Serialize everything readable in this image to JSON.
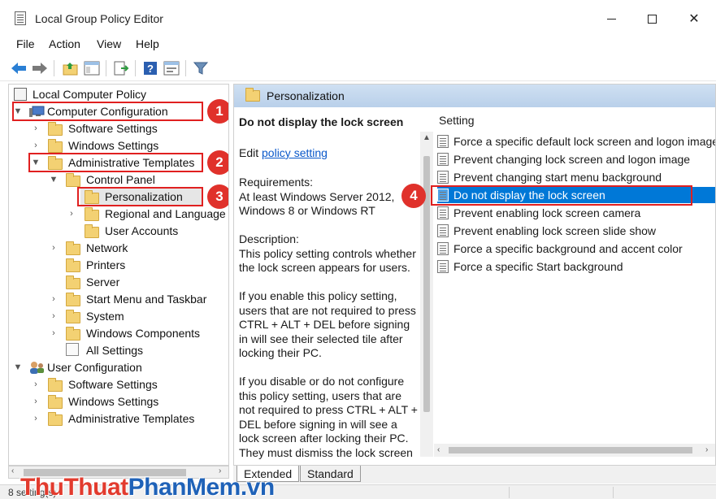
{
  "window": {
    "title": "Local Group Policy Editor"
  },
  "menu": [
    "File",
    "Action",
    "View",
    "Help"
  ],
  "tree": {
    "root": "Local Computer Policy",
    "computer_configuration": "Computer Configuration",
    "software_settings": "Software Settings",
    "windows_settings": "Windows Settings",
    "administrative_templates": "Administrative Templates",
    "control_panel": "Control Panel",
    "personalization": "Personalization",
    "regional_and_language": "Regional and Language C",
    "user_accounts": "User Accounts",
    "network": "Network",
    "printers": "Printers",
    "server": "Server",
    "start_menu_and_taskbar": "Start Menu and Taskbar",
    "system": "System",
    "windows_components": "Windows Components",
    "all_settings": "All Settings",
    "user_configuration": "User Configuration",
    "user_software_settings": "Software Settings",
    "user_windows_settings": "Windows Settings",
    "user_administrative_templates": "Administrative Templates"
  },
  "badges": [
    "1",
    "2",
    "3",
    "4"
  ],
  "right_header": "Personalization",
  "description": {
    "title": "Do not display the lock screen",
    "edit_prefix": "Edit ",
    "edit_link": "policy setting",
    "body": "Requirements:\nAt least Windows Server 2012, Windows 8 or Windows RT\n\nDescription:\nThis policy setting controls whether the lock screen appears for users.\n\nIf you enable this policy setting, users that are not required to press CTRL + ALT + DEL before signing in will see their selected tile after locking their PC.\n\nIf you disable or do not configure this policy setting, users that are not required to press CTRL + ALT + DEL before signing in will see a lock screen after locking their PC. They must dismiss the lock screen"
  },
  "settings": {
    "header": "Setting",
    "items": [
      "Force a specific default lock screen and logon image",
      "Prevent changing lock screen and logon image",
      "Prevent changing start menu background",
      "Do not display the lock screen",
      "Prevent enabling lock screen camera",
      "Prevent enabling lock screen slide show",
      "Force a specific background and accent color",
      "Force a specific Start background"
    ],
    "selected_index": 3
  },
  "tabs": [
    "Extended",
    "Standard"
  ],
  "status": "8 setting(s)",
  "watermark": {
    "part1": "Thu",
    "part2": "Thuat",
    "part3": "PhanMem",
    "part4": ".vn"
  },
  "colors": {
    "selection": "#0078d7",
    "highlight_box": "#e02020",
    "badge": "#e0312b"
  }
}
